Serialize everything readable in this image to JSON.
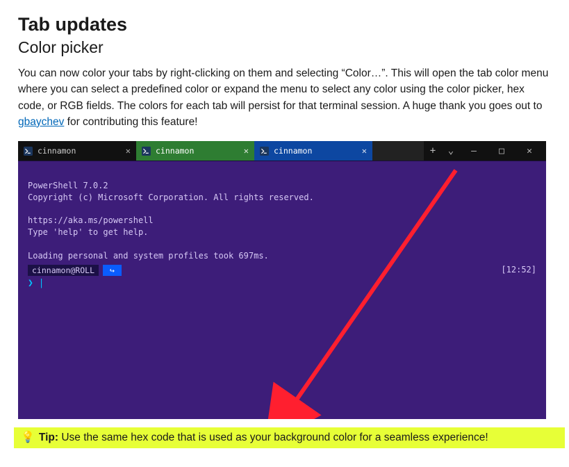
{
  "heading": "Tab updates",
  "subheading": "Color picker",
  "intro": {
    "part1": "You can now color your tabs by right-clicking on them and selecting “Color…”. This will open the tab color menu where you can select a predefined color or expand the menu to select any color using the color picker, hex code, or RGB fields. The colors for each tab will persist for that terminal session. A huge thank you goes out to ",
    "link_text": "gbaychev",
    "part2": " for contributing this feature!"
  },
  "terminal": {
    "tabs": [
      {
        "label": "cinnamon",
        "color_class": "black"
      },
      {
        "label": "cinnamon",
        "color_class": "green"
      },
      {
        "label": "cinnamon",
        "color_class": "blue"
      }
    ],
    "new_tab": "+",
    "dropdown": "⌄",
    "minimize": "—",
    "maximize": "□",
    "close": "✕",
    "lines": {
      "l1": "PowerShell 7.0.2",
      "l2": "Copyright (c) Microsoft Corporation. All rights reserved.",
      "l3": "https://aka.ms/powershell",
      "l4": "Type 'help' to get help.",
      "l5": "Loading personal and system profiles took 697ms."
    },
    "prompt_user": "cinnamon@ROLL",
    "prompt_path_glyph": "↪",
    "prompt_time": "[12:52]",
    "prompt_caret": "❯",
    "cursor": "|"
  },
  "tip": {
    "label": "Tip:",
    "text": " Use the same hex code that is used as your background color for a seamless experience!"
  }
}
